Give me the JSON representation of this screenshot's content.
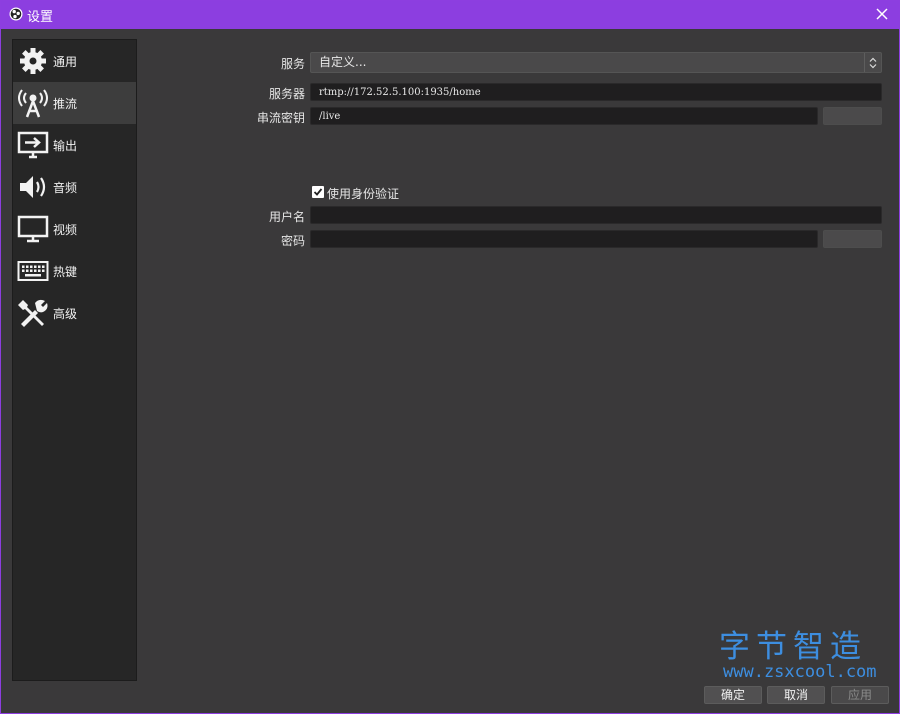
{
  "window": {
    "title": "设置",
    "accent_color": "#8c3ee0",
    "close_icon": "close-icon"
  },
  "sidebar": {
    "items": [
      {
        "label": "通用",
        "icon": "gear-icon",
        "active": false
      },
      {
        "label": "推流",
        "icon": "broadcast-antenna-icon",
        "active": true
      },
      {
        "label": "输出",
        "icon": "output-monitor-icon",
        "active": false
      },
      {
        "label": "音频",
        "icon": "speaker-icon",
        "active": false
      },
      {
        "label": "视频",
        "icon": "monitor-icon",
        "active": false
      },
      {
        "label": "热键",
        "icon": "keyboard-icon",
        "active": false
      },
      {
        "label": "高级",
        "icon": "tools-icon",
        "active": false
      }
    ]
  },
  "stream": {
    "service_label": "服务",
    "service_value": "自定义...",
    "server_label": "服务器",
    "server_value": "rtmp://172.52.5.100:1935/home",
    "key_label": "串流密钥",
    "key_value": "/live",
    "auth_checkbox_label": "使用身份验证",
    "auth_checked": true,
    "username_label": "用户名",
    "username_value": "",
    "password_label": "密码",
    "password_value": ""
  },
  "footer": {
    "ok_label": "确定",
    "cancel_label": "取消",
    "apply_label": "应用"
  },
  "watermark": {
    "text_cn": "字节智造",
    "url": "www.zsxcool.com",
    "color": "#3d8ee0"
  }
}
